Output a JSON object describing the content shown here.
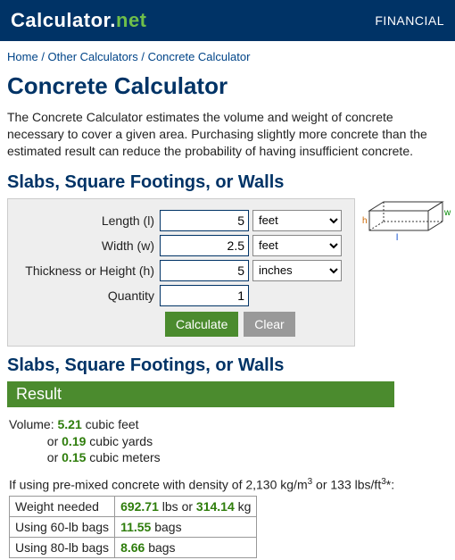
{
  "header": {
    "logo": "Calculator",
    "logo_suffix": "net",
    "nav_financial": "FINANCIAL"
  },
  "breadcrumbs": {
    "home": "Home",
    "other": "Other Calculators",
    "current": "Concrete Calculator"
  },
  "page": {
    "title": "Concrete Calculator",
    "intro": "The Concrete Calculator estimates the volume and weight of concrete necessary to cover a given area. Purchasing slightly more concrete than the estimated result can reduce the probability of having insufficient concrete."
  },
  "section1": {
    "heading": "Slabs, Square Footings, or Walls",
    "labels": {
      "length": "Length (l)",
      "width": "Width (w)",
      "thickness": "Thickness or Height (h)",
      "quantity": "Quantity"
    },
    "values": {
      "length": "5",
      "width": "2.5",
      "thickness": "5",
      "quantity": "1"
    },
    "units": {
      "length": "feet",
      "width": "feet",
      "thickness": "inches"
    },
    "buttons": {
      "calculate": "Calculate",
      "clear": "Clear"
    },
    "diagram": {
      "h": "h",
      "l": "l",
      "w": "w"
    }
  },
  "result": {
    "heading": "Slabs, Square Footings, or Walls",
    "bar": "Result",
    "volume_label": "Volume:",
    "cubic_feet_val": "5.21",
    "cubic_feet_unit": "cubic feet",
    "or1": "or",
    "cubic_yards_val": "0.19",
    "cubic_yards_unit": "cubic yards",
    "or2": "or",
    "cubic_meters_val": "0.15",
    "cubic_meters_unit": "cubic meters",
    "density_pre": "If using pre-mixed concrete with density of 2,130 kg/m",
    "density_sup1": "3",
    "density_mid": " or 133 lbs/ft",
    "density_sup2": "3",
    "density_post": "*:",
    "table": {
      "weight_label": "Weight needed",
      "weight_lbs": "692.71",
      "weight_lbs_unit": "lbs or",
      "weight_kg": "314.14",
      "weight_kg_unit": "kg",
      "bags60_label": "Using 60-lb bags",
      "bags60_val": "11.55",
      "bags60_unit": "bags",
      "bags80_label": "Using 80-lb bags",
      "bags80_val": "8.66",
      "bags80_unit": "bags"
    }
  }
}
